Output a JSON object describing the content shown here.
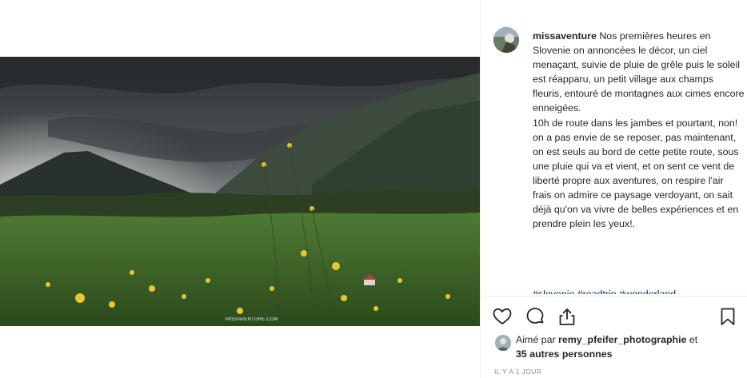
{
  "post": {
    "username": "missaventure",
    "caption": "Nos premières heures en Slovenie on annoncées le décor, un ciel menaçant, suivie de pluie de grêle puis le soleil est réapparu, un petit village aux champs fleuris, entouré de montagnes aux cimes encore enneigées.\n10h de route dans les jambes et pourtant, non! on a pas envie de se reposer, pas maintenant, on est seuls au bord de cette petite route, sous une pluie qui va et vient, et on sent ce vent de liberté propre aux aventures, on respire l'air frais on admire ce paysage verdoyant, on sait déjà qu'on va vivre de belles expériences et en prendre plein les yeux!.",
    "hashtags": "#slovenie #roadtrip #wonderland",
    "photo_watermark": "MISSAVENTURE.COM"
  },
  "likes": {
    "prefix": "Aimé par ",
    "liker": "remy_pfeifer_photographie",
    "connector": " et",
    "others": "35 autres personnes"
  },
  "timestamp": "IL Y A 1 JOUR",
  "icons": {
    "like": "heart-icon",
    "comment": "comment-bubble-icon",
    "share": "share-icon",
    "save": "bookmark-icon"
  },
  "colors": {
    "text": "#262626",
    "muted": "#8e8e8e",
    "link": "#00376b",
    "divider": "#efefef"
  }
}
